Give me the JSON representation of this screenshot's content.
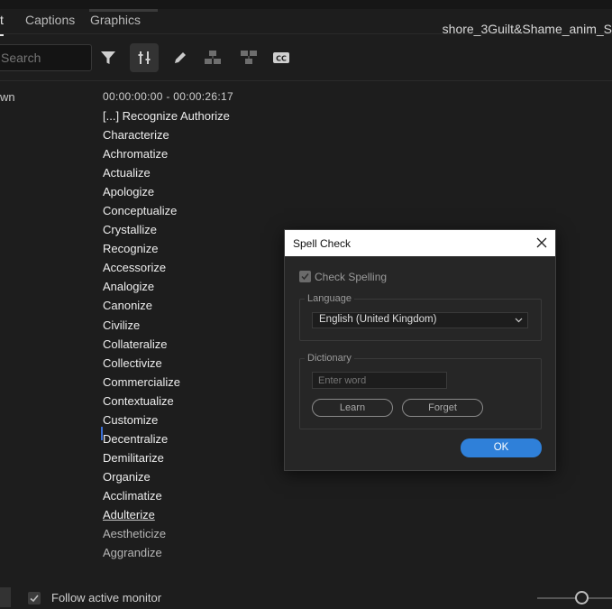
{
  "tabs": [
    {
      "label": "t",
      "active": true
    },
    {
      "label": "Captions",
      "active": false
    },
    {
      "label": "Graphics",
      "active": false
    }
  ],
  "sequence_title": "shore_3Guilt&Shame_anim_S",
  "search": {
    "placeholder": "Search"
  },
  "toolbar_icons": [
    "filter-icon",
    "adjust-icon",
    "pencil-icon",
    "split-icon",
    "merge-icon",
    "cc-icon"
  ],
  "transcript": {
    "speaker_label": "wn",
    "timecode": "00:00:00:00 - 00:00:26:17",
    "words": [
      "[...] Recognize Authorize",
      "Characterize",
      "Achromatize",
      "Actualize",
      "Apologize",
      "Conceptualize",
      "Crystallize",
      "Recognize",
      "Accessorize",
      "Analogize",
      "Canonize",
      "Civilize",
      "Collateralize",
      "Collectivize",
      "Commercialize",
      "Contextualize",
      "Customize",
      "Decentralize",
      "Demilitarize",
      "Organize",
      "Acclimatize",
      "Adulterize",
      "Aestheticize",
      "Aggrandize"
    ]
  },
  "footer": {
    "follow_label": "Follow active monitor"
  },
  "dialog": {
    "title": "Spell Check",
    "check_spelling_label": "Check Spelling",
    "language_group": "Language",
    "language_value": "English (United Kingdom)",
    "dictionary_group": "Dictionary",
    "word_placeholder": "Enter word",
    "learn_label": "Learn",
    "forget_label": "Forget",
    "ok_label": "OK"
  },
  "colors": {
    "accent": "#2f80d9",
    "background": "#1d1d1d",
    "dialog": "#262626"
  }
}
